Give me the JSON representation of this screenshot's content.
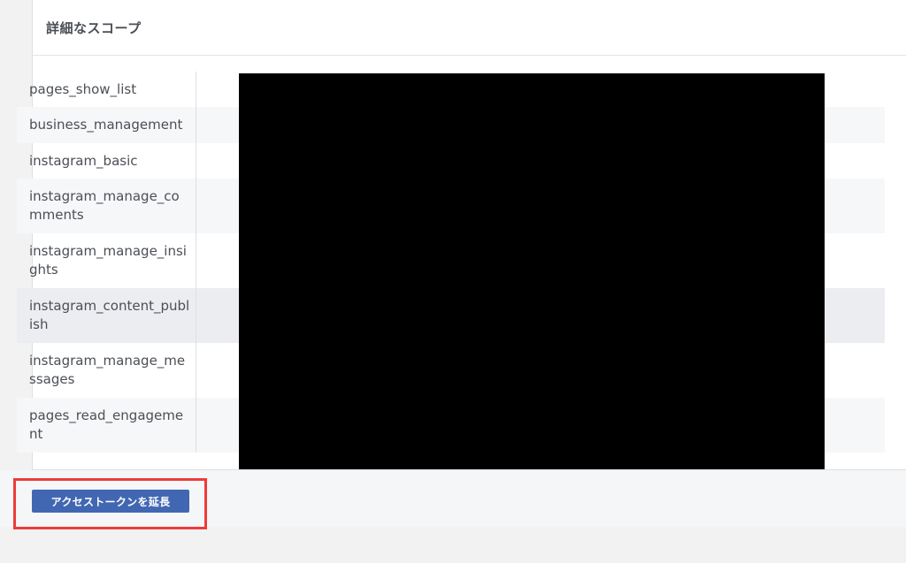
{
  "section": {
    "title": "詳細なスコープ"
  },
  "scopes": [
    {
      "name": "pages_show_list"
    },
    {
      "name": "business_management"
    },
    {
      "name": "instagram_basic"
    },
    {
      "name": "instagram_manage_comments"
    },
    {
      "name": "instagram_manage_insights"
    },
    {
      "name": "instagram_content_publish"
    },
    {
      "name": "instagram_manage_messages"
    },
    {
      "name": "pages_read_engagement"
    }
  ],
  "actions": {
    "extend_token_label": "アクセストークンを延長"
  },
  "colors": {
    "button": "#4267b2",
    "highlight_frame": "#ee3b3b",
    "redaction": "#000000"
  }
}
